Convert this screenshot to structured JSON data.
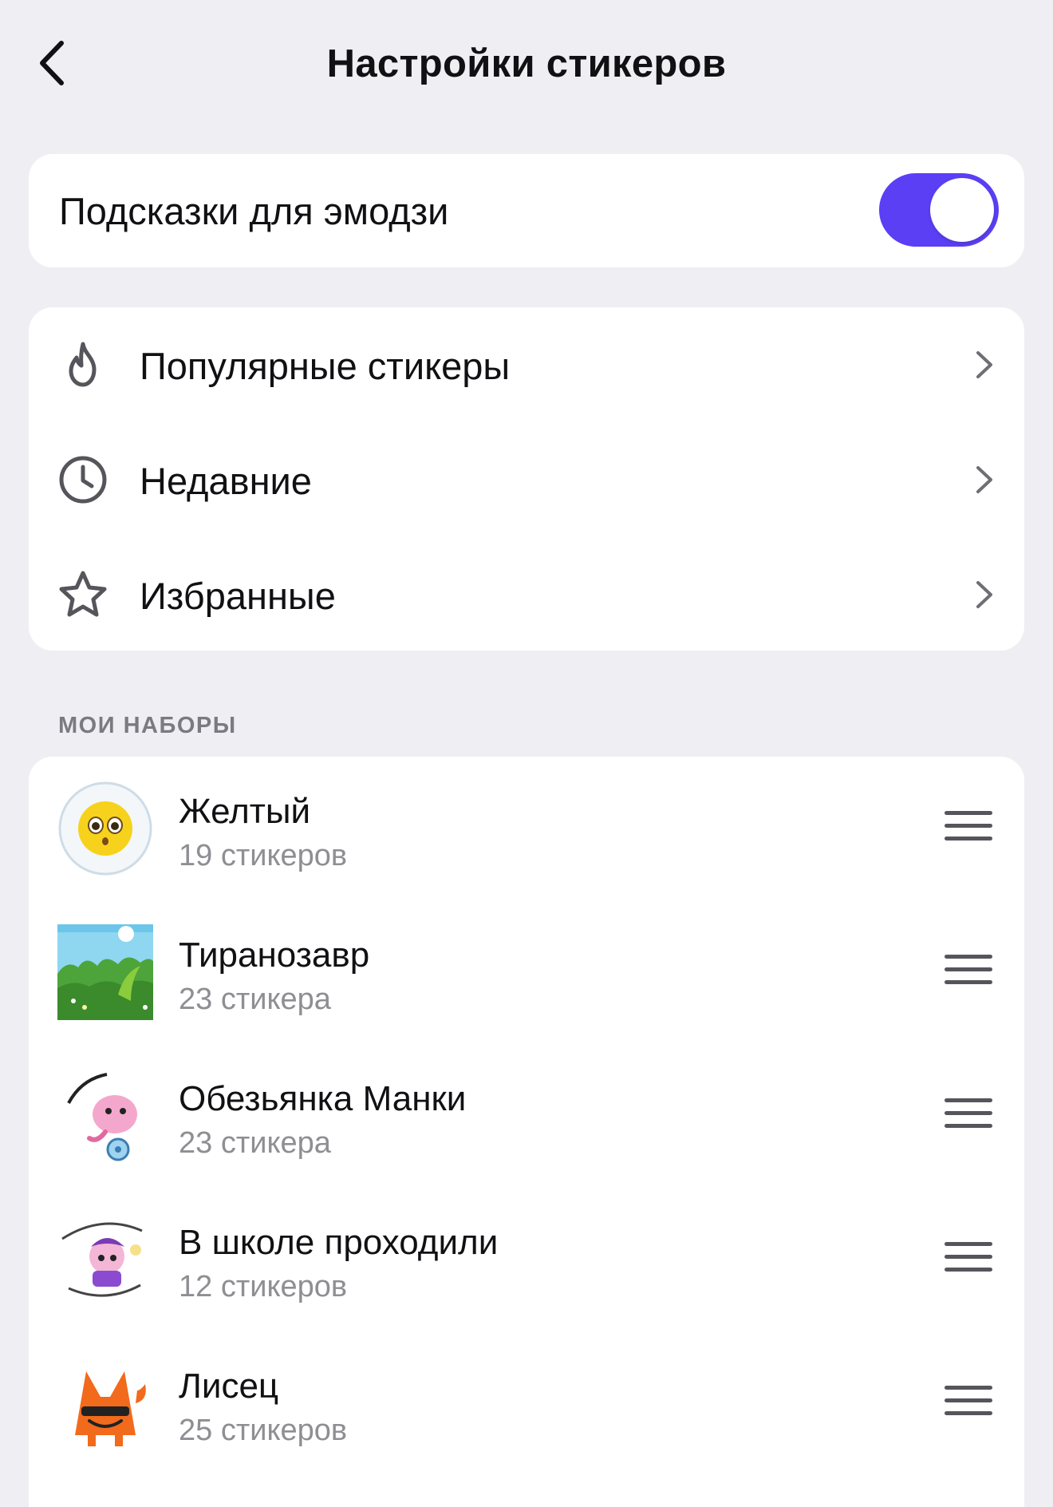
{
  "header": {
    "title": "Настройки стикеров",
    "back_icon": "chevron-left-icon"
  },
  "emoji_hints": {
    "label": "Подсказки для эмодзи",
    "enabled": true,
    "accent_color": "#5a3ff5"
  },
  "nav": {
    "items": [
      {
        "label": "Популярные стикеры",
        "icon": "flame-icon"
      },
      {
        "label": "Недавние",
        "icon": "clock-icon"
      },
      {
        "label": "Избранные",
        "icon": "star-icon"
      }
    ]
  },
  "my_sets": {
    "section_title": "МОИ НАБОРЫ",
    "items": [
      {
        "name": "Желтый",
        "count": "19 стикеров",
        "thumb": "yellow-face-sticker"
      },
      {
        "name": "Тиранозавр",
        "count": "23 стикера",
        "thumb": "dino-landscape-sticker"
      },
      {
        "name": "Обезьянка Манки",
        "count": "23 стикера",
        "thumb": "monkey-privet-sticker"
      },
      {
        "name": "В школе проходили",
        "count": "12 стикеров",
        "thumb": "school-monkey-sticker"
      },
      {
        "name": "Лисец",
        "count": "25 стикеров",
        "thumb": "fox-sticker"
      }
    ]
  }
}
